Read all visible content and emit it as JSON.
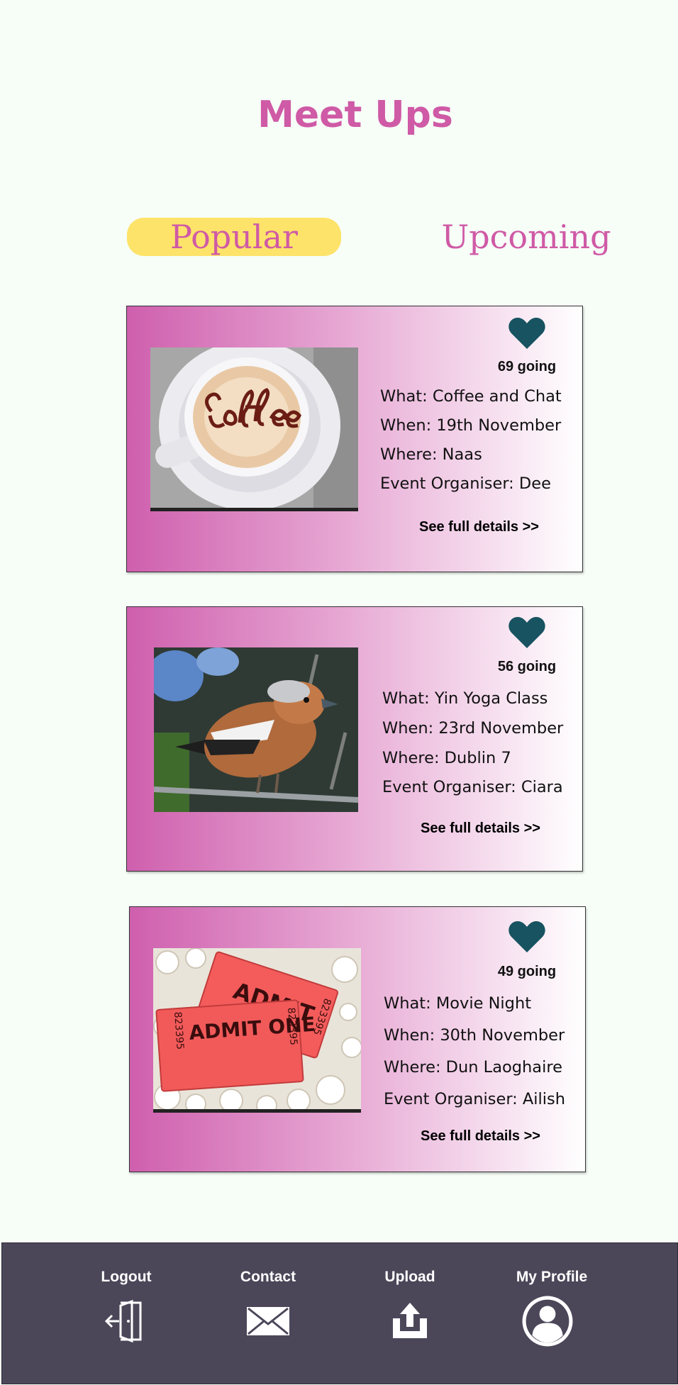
{
  "header": {
    "title": "Meet Ups"
  },
  "tabs": [
    {
      "label": "Popular",
      "active": true
    },
    {
      "label": "Upcoming",
      "active": false
    }
  ],
  "colors": {
    "accent": "#cf5aa6",
    "tab_active_bg": "#fde36a",
    "heart": "#175360",
    "navbar": "#4b4759"
  },
  "events": [
    {
      "image": "coffee-cup-image",
      "going": "69 going",
      "what": "What: Coffee and Chat",
      "when": "When: 19th November",
      "where": "Where: Naas",
      "organiser": "Event Organiser: Dee",
      "details": "See full details >>"
    },
    {
      "image": "bird-image",
      "going": "56 going",
      "what": "What: Yin Yoga Class",
      "when": "When: 23rd November",
      "where": "Where: Dublin 7",
      "organiser": "Event Organiser: Ciara",
      "details": "See full details >>"
    },
    {
      "image": "movie-tickets-image",
      "image_text": {
        "ticket_front": "ADMIT ONE",
        "ticket_back": "ADMIT",
        "serial": "823395"
      },
      "going": "49 going",
      "what": "What: Movie Night",
      "when": "When: 30th November",
      "where": "Where: Dun Laoghaire",
      "organiser": "Event Organiser: Ailish",
      "details": "See full details >>"
    }
  ],
  "nav": [
    {
      "label": "Logout",
      "icon": "logout-door-icon"
    },
    {
      "label": "Contact",
      "icon": "envelope-icon"
    },
    {
      "label": "Upload",
      "icon": "upload-icon"
    },
    {
      "label": "My Profile",
      "icon": "profile-user-icon"
    }
  ]
}
